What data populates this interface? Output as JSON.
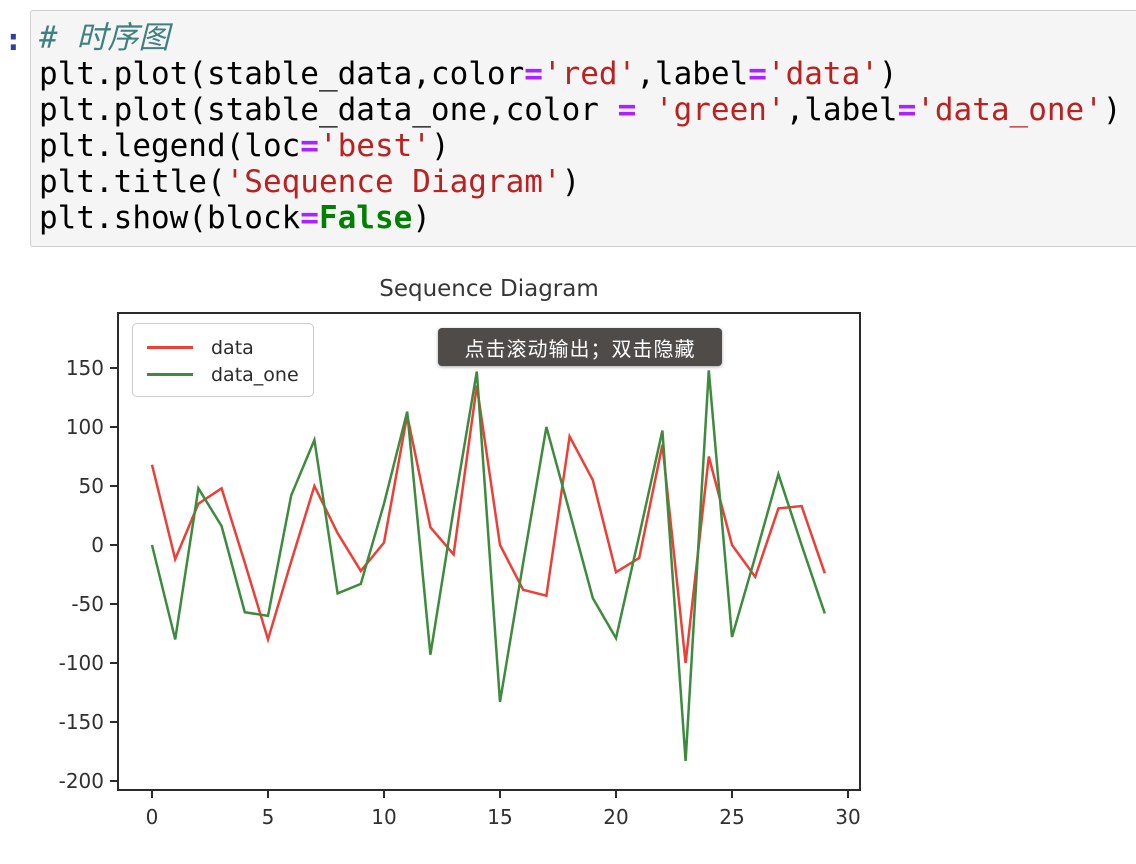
{
  "notebook": {
    "prompt_colon": ":",
    "code_lines": [
      [
        [
          "com",
          "# 时序图"
        ]
      ],
      [
        [
          "txt",
          "plt.plot(stable_data,color"
        ],
        [
          "op",
          "="
        ],
        [
          "str",
          "'red'"
        ],
        [
          "txt",
          ",label"
        ],
        [
          "op",
          "="
        ],
        [
          "str",
          "'data'"
        ],
        [
          "txt",
          ")"
        ]
      ],
      [
        [
          "txt",
          "plt.plot(stable_data_one,color "
        ],
        [
          "op",
          "="
        ],
        [
          "txt",
          " "
        ],
        [
          "str",
          "'green'"
        ],
        [
          "txt",
          ",label"
        ],
        [
          "op",
          "="
        ],
        [
          "str",
          "'data_one'"
        ],
        [
          "txt",
          ")"
        ]
      ],
      [
        [
          "txt",
          "plt.legend(loc"
        ],
        [
          "op",
          "="
        ],
        [
          "str",
          "'best'"
        ],
        [
          "txt",
          ")"
        ]
      ],
      [
        [
          "txt",
          "plt.title("
        ],
        [
          "str",
          "'Sequence Diagram'"
        ],
        [
          "txt",
          ")"
        ]
      ],
      [
        [
          "txt",
          "plt.show(block"
        ],
        [
          "op",
          "="
        ],
        [
          "kw",
          "False"
        ],
        [
          "txt",
          ")"
        ]
      ]
    ]
  },
  "tooltip": {
    "text": "点击滚动输出；双击隐藏"
  },
  "chart_data": {
    "type": "line",
    "title": "Sequence Diagram",
    "x": [
      0,
      1,
      2,
      3,
      4,
      5,
      6,
      7,
      8,
      9,
      10,
      11,
      12,
      13,
      14,
      15,
      16,
      17,
      18,
      19,
      20,
      21,
      22,
      23,
      24,
      25,
      26,
      27,
      28,
      29
    ],
    "series": [
      {
        "name": "data",
        "color_name": "red",
        "hex": "#ee3e36",
        "values": [
          68,
          -12,
          35,
          48,
          -15,
          -80,
          -14,
          50,
          10,
          -22,
          2,
          110,
          15,
          -8,
          135,
          0,
          -38,
          -43,
          92,
          55,
          -23,
          -11,
          85,
          -100,
          75,
          0,
          -27,
          31,
          33,
          -24
        ]
      },
      {
        "name": "data_one",
        "color_name": "green",
        "hex": "#3d8b3d",
        "values": [
          0,
          -80,
          48,
          16,
          -57,
          -60,
          42,
          89,
          -41,
          -33,
          35,
          113,
          -93,
          30,
          147,
          -133,
          -15,
          100,
          28,
          -45,
          -79,
          8,
          97,
          -183,
          148,
          -78,
          -10,
          60,
          0,
          -58
        ]
      }
    ],
    "xticks": [
      0,
      5,
      10,
      15,
      20,
      25,
      30
    ],
    "yticks": [
      150,
      100,
      50,
      0,
      -50,
      -100,
      -150,
      -200
    ],
    "xlim": [
      -1.45,
      30.5
    ],
    "ylim": [
      -207,
      196
    ],
    "grid": false,
    "legend_position": "upper left",
    "axis_color": "#2b2b2b",
    "tick_label_color": "#303030"
  }
}
